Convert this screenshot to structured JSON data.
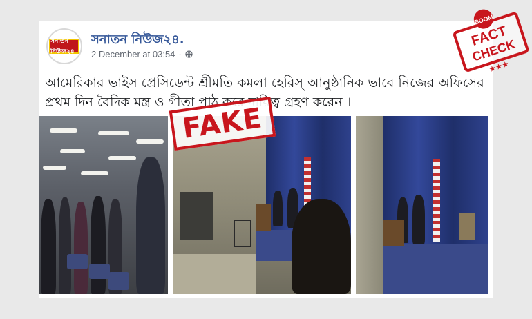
{
  "post": {
    "page_name": "সনাতন নিউজ২৪.",
    "timestamp": "2 December at 03:54",
    "avatar_text": "সনাতন নিউজ২৪",
    "text": "আমেরিকার ভাইস প্রেসিডেন্ট শ্রীমতি কমলা হেরিস্ আনুষ্ঠানিক ভাবে নিজের অফিসের প্রথম দিন বৈদিক মন্ত্র ও গীতা পাঠ করে দায়িত্ব গ্রহণ করেন ।"
  },
  "overlay": {
    "fake_label": "FAKE",
    "boom_label": "BOOM",
    "fact_label": "FACT",
    "check_label": "CHECK",
    "stars": "★★★"
  },
  "colors": {
    "page_name": "#365899",
    "stamp_red": "#c8161d"
  },
  "icons": [
    "globe-icon"
  ]
}
